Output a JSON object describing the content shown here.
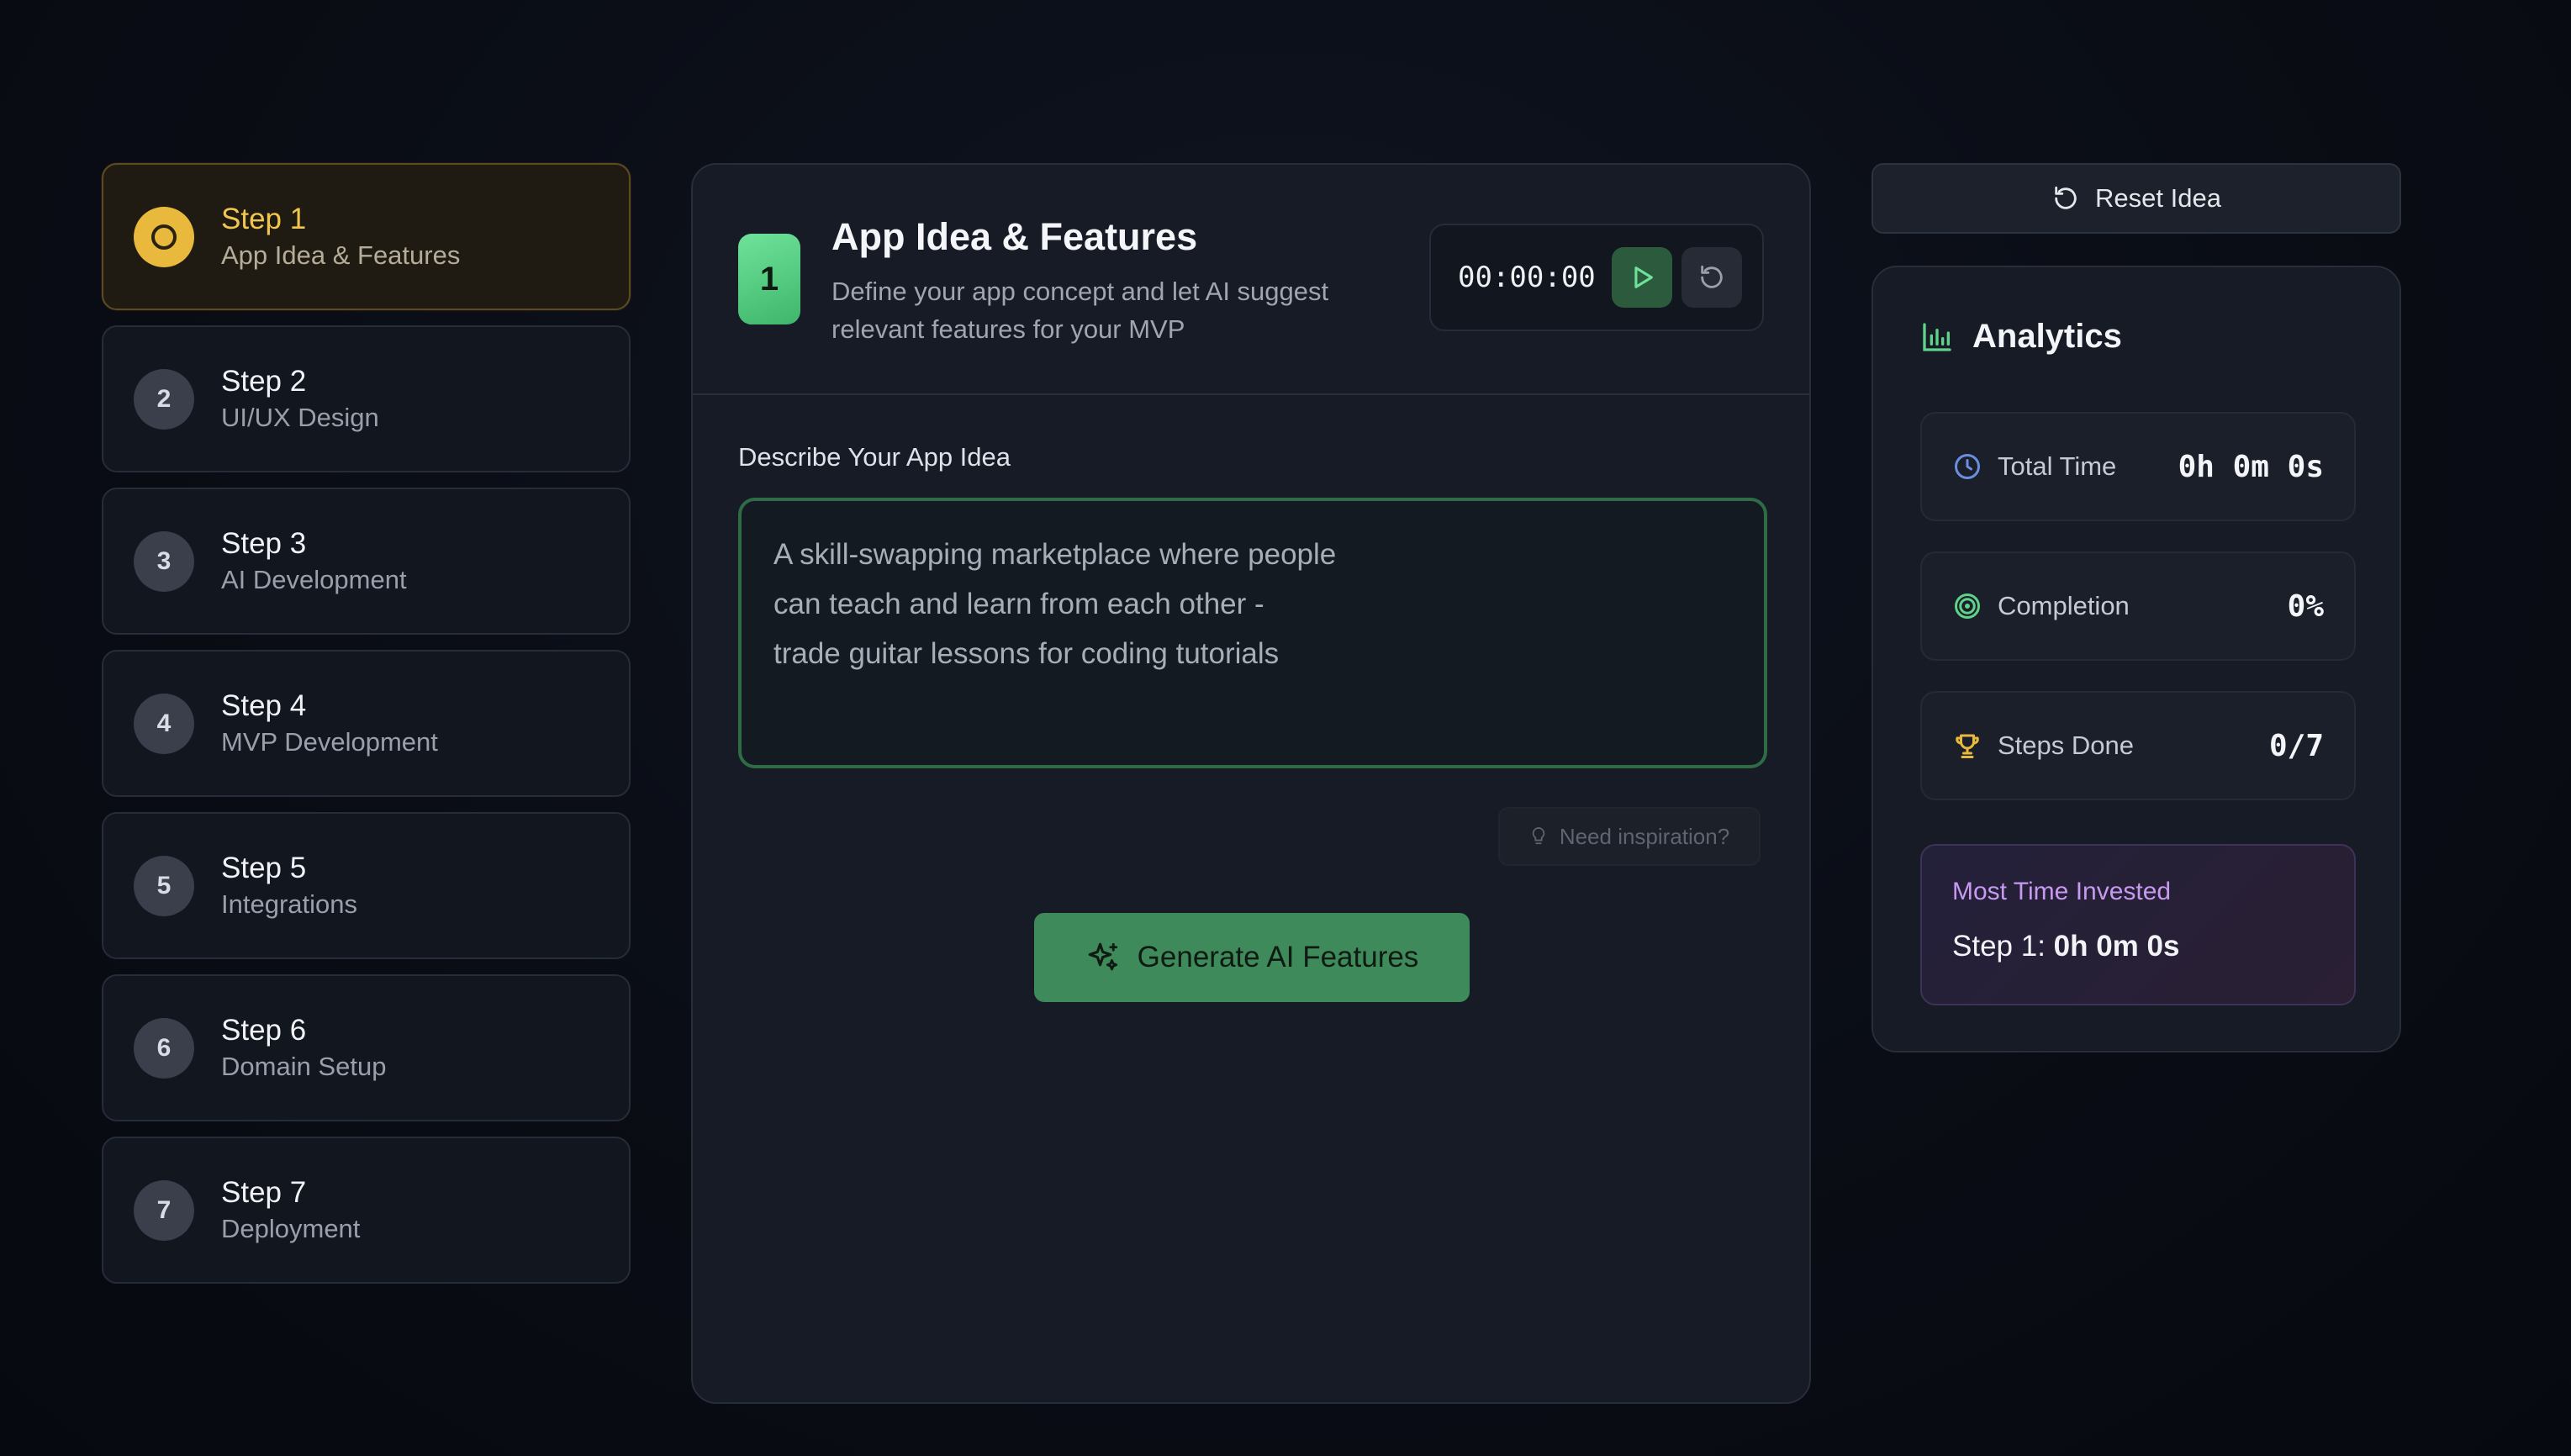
{
  "steps": [
    {
      "number": "1",
      "title": "Step 1",
      "subtitle": "App Idea & Features",
      "active": true
    },
    {
      "number": "2",
      "title": "Step 2",
      "subtitle": "UI/UX Design"
    },
    {
      "number": "3",
      "title": "Step 3",
      "subtitle": "AI Development"
    },
    {
      "number": "4",
      "title": "Step 4",
      "subtitle": "MVP Development"
    },
    {
      "number": "5",
      "title": "Step 5",
      "subtitle": "Integrations"
    },
    {
      "number": "6",
      "title": "Step 6",
      "subtitle": "Domain Setup"
    },
    {
      "number": "7",
      "title": "Step 7",
      "subtitle": "Deployment"
    }
  ],
  "main": {
    "badge": "1",
    "title": "App Idea & Features",
    "subtitle": "Define your app concept and let AI suggest relevant features for your MVP",
    "timer": "00:00:00",
    "field_label": "Describe Your App Idea",
    "idea_text": "A skill-swapping marketplace where people\ncan teach and learn from each other -\ntrade guitar lessons for coding tutorials",
    "inspiration_label": "Need inspiration?",
    "generate_label": "Generate AI Features"
  },
  "right": {
    "reset_label": "Reset Idea",
    "analytics_title": "Analytics",
    "stats": [
      {
        "label": "Total Time",
        "value": "0h 0m 0s",
        "icon": "clock-icon"
      },
      {
        "label": "Completion",
        "value": "0%",
        "icon": "target-icon"
      },
      {
        "label": "Steps Done",
        "value": "0/7",
        "icon": "trophy-icon"
      }
    ],
    "most_time_heading": "Most Time Invested",
    "most_time_step": "Step 1: ",
    "most_time_value": "0h 0m 0s"
  },
  "colors": {
    "accent_green": "#3f8a5a",
    "active_step": "#e9b93d",
    "purple_heading": "#c79af0"
  }
}
